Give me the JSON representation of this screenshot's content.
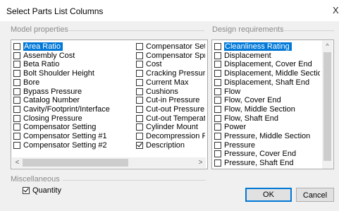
{
  "dialog": {
    "title": "Select Parts List Columns",
    "close_glyph": "X"
  },
  "model_properties": {
    "label": "Model properties",
    "col1": [
      {
        "label": "Area Ratio",
        "checked": false,
        "selected": true
      },
      {
        "label": "Assembly Cost",
        "checked": false
      },
      {
        "label": "Beta Ratio",
        "checked": false
      },
      {
        "label": "Bolt Shoulder Height",
        "checked": false
      },
      {
        "label": "Bore",
        "checked": false
      },
      {
        "label": "Bypass Pressure",
        "checked": false
      },
      {
        "label": "Catalog Number",
        "checked": false
      },
      {
        "label": "Cavity/Footprint/Interface",
        "checked": false
      },
      {
        "label": "Closing Pressure",
        "checked": false
      },
      {
        "label": "Compensator Setting",
        "checked": false
      },
      {
        "label": "Compensator Setting  #1",
        "checked": false
      },
      {
        "label": "Compensator Setting #2",
        "checked": false
      }
    ],
    "col2": [
      {
        "label": "Compensator Setting",
        "checked": false
      },
      {
        "label": "Compensator Spring",
        "checked": false
      },
      {
        "label": "Cost",
        "checked": false
      },
      {
        "label": "Cracking Pressure",
        "checked": false
      },
      {
        "label": "Current Max",
        "checked": false
      },
      {
        "label": "Cushions",
        "checked": false
      },
      {
        "label": "Cut-in Pressure",
        "checked": false
      },
      {
        "label": "Cut-out Pressure",
        "checked": false
      },
      {
        "label": "Cut-out Temperature",
        "checked": false
      },
      {
        "label": "Cylinder Mount",
        "checked": false
      },
      {
        "label": "Decompression Rate",
        "checked": false
      },
      {
        "label": "Description",
        "checked": true
      }
    ]
  },
  "design_requirements": {
    "label": "Design requirements",
    "items": [
      {
        "label": "Cleanliness Rating",
        "checked": false,
        "selected": true
      },
      {
        "label": "Displacement",
        "checked": false
      },
      {
        "label": "Displacement, Cover End",
        "checked": false
      },
      {
        "label": "Displacement, Middle Section",
        "checked": false
      },
      {
        "label": "Displacement, Shaft End",
        "checked": false
      },
      {
        "label": "Flow",
        "checked": false
      },
      {
        "label": "Flow, Cover End",
        "checked": false
      },
      {
        "label": "Flow, Middle Section",
        "checked": false
      },
      {
        "label": "Flow, Shaft End",
        "checked": false
      },
      {
        "label": "Power",
        "checked": false
      },
      {
        "label": "Pressure, Middle Section",
        "checked": false
      },
      {
        "label": "Pressure",
        "checked": false
      },
      {
        "label": "Pressure, Cover End",
        "checked": false
      },
      {
        "label": "Pressure, Shaft End",
        "checked": false
      }
    ]
  },
  "miscellaneous": {
    "label": "Miscellaneous",
    "quantity": {
      "label": "Quantity",
      "checked": true
    }
  },
  "buttons": {
    "ok": "OK",
    "cancel": "Cancel"
  },
  "scroll_glyphs": {
    "left": "<",
    "right": ">",
    "up": "^",
    "down": "v"
  }
}
